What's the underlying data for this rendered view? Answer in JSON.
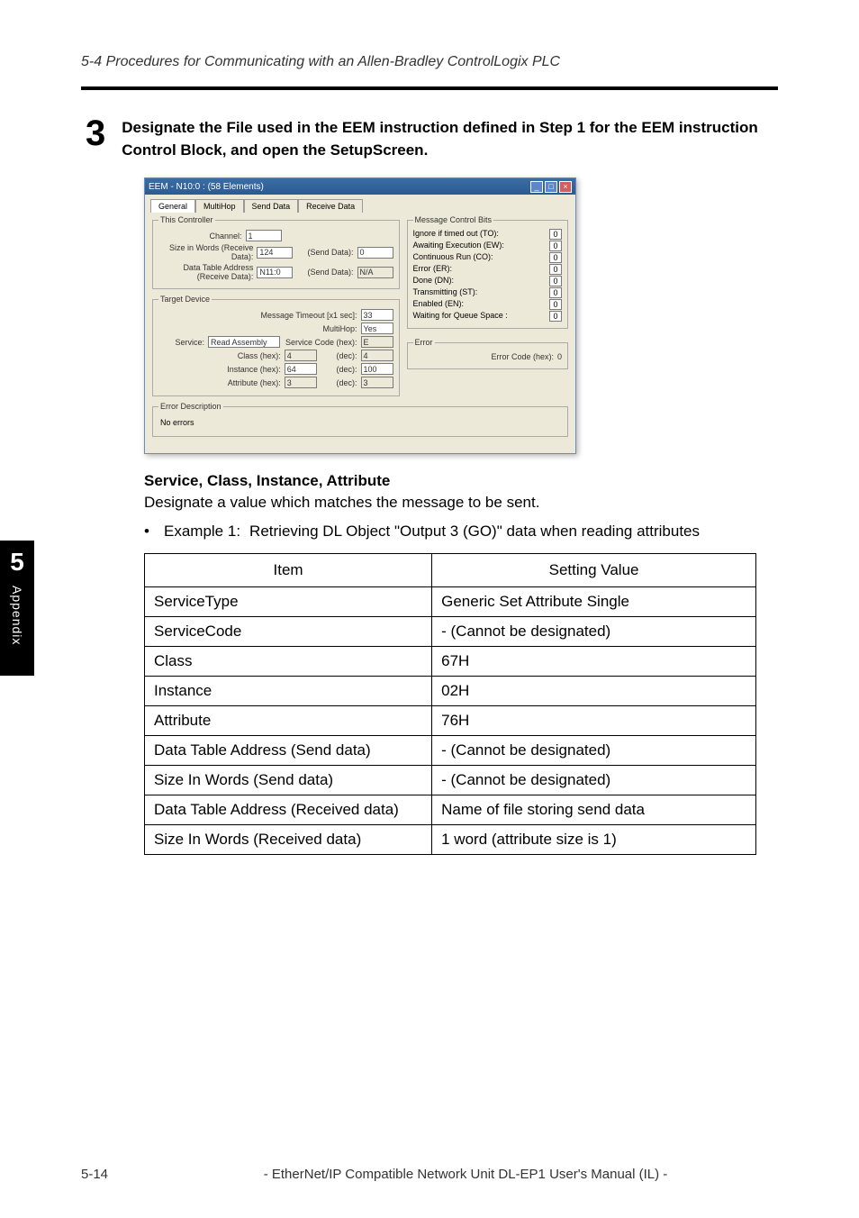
{
  "running_head": "5-4 Procedures for Communicating with an Allen-Bradley ControlLogix PLC",
  "step": {
    "number": "3",
    "text": "Designate the File used in the EEM instruction defined in Step 1 for the EEM instruction Control Block, and open the SetupScreen."
  },
  "side_tab": {
    "number": "5",
    "label": "Appendix"
  },
  "window": {
    "title": "EEM - N10:0 : (58 Elements)",
    "tabs": [
      "General",
      "MultiHop",
      "Send Data",
      "Receive Data"
    ],
    "this_controller": {
      "legend": "This Controller",
      "channel_label": "Channel:",
      "channel": "1",
      "size_recv_label": "Size in Words (Receive Data):",
      "size_recv": "124",
      "send_data1_label": "(Send Data):",
      "send_data1": "0",
      "dta_recv_label": "Data Table Address (Receive Data):",
      "dta_recv": "N11:0",
      "send_data2_label": "(Send Data):",
      "send_data2": "N/A"
    },
    "target_device": {
      "legend": "Target Device",
      "msg_to_label": "Message Timeout [x1 sec]:",
      "msg_to": "33",
      "multihop_label": "MultiHop:",
      "multihop": "Yes",
      "service_label": "Service:",
      "service": "Read Assembly",
      "service_code_label": "Service Code (hex):",
      "service_code": "E",
      "class_hex_label": "Class (hex):",
      "class_hex": "4",
      "class_dec_label": "(dec):",
      "class_dec": "4",
      "instance_hex_label": "Instance (hex):",
      "instance_hex": "64",
      "instance_dec_label": "(dec):",
      "instance_dec": "100",
      "attribute_hex_label": "Attribute (hex):",
      "attribute_hex": "3",
      "attribute_dec_label": "(dec):",
      "attribute_dec": "3"
    },
    "control_bits": {
      "legend": "Message Control Bits",
      "rows": [
        {
          "label": "Ignore if timed out (TO):",
          "val": "0"
        },
        {
          "label": "Awaiting Execution (EW):",
          "val": "0"
        },
        {
          "label": "Continuous Run (CO):",
          "val": "0"
        },
        {
          "label": "Error (ER):",
          "val": "0"
        },
        {
          "label": "Done (DN):",
          "val": "0"
        },
        {
          "label": "Transmitting (ST):",
          "val": "0"
        },
        {
          "label": "Enabled (EN):",
          "val": "0"
        },
        {
          "label": "Waiting for Queue Space :",
          "val": "0"
        }
      ]
    },
    "error_box": {
      "legend": "Error",
      "label": "Error Code (hex):",
      "val": "0"
    },
    "error_desc": {
      "legend": "Error Description",
      "text": "No errors"
    }
  },
  "sub": {
    "heading": "Service, Class, Instance, Attribute",
    "text": "Designate a value which matches the message to be sent.",
    "example_label": "Example 1:",
    "example_text": "Retrieving DL Object \"Output 3 (GO)\" data when reading attributes"
  },
  "table": {
    "headers": [
      "Item",
      "Setting Value"
    ],
    "rows": [
      [
        "ServiceType",
        "Generic Set Attribute Single"
      ],
      [
        "ServiceCode",
        "- (Cannot be designated)"
      ],
      [
        "Class",
        "67H"
      ],
      [
        "Instance",
        "02H"
      ],
      [
        "Attribute",
        "76H"
      ],
      [
        "Data Table Address (Send data)",
        "- (Cannot be designated)"
      ],
      [
        "Size In Words (Send data)",
        "- (Cannot be designated)"
      ],
      [
        "Data Table Address (Received data)",
        "Name of file storing send data"
      ],
      [
        "Size In Words (Received data)",
        "1 word (attribute size is 1)"
      ]
    ]
  },
  "footer": {
    "page": "5-14",
    "title": "- EtherNet/IP Compatible Network Unit DL-EP1 User's Manual (IL) -"
  }
}
